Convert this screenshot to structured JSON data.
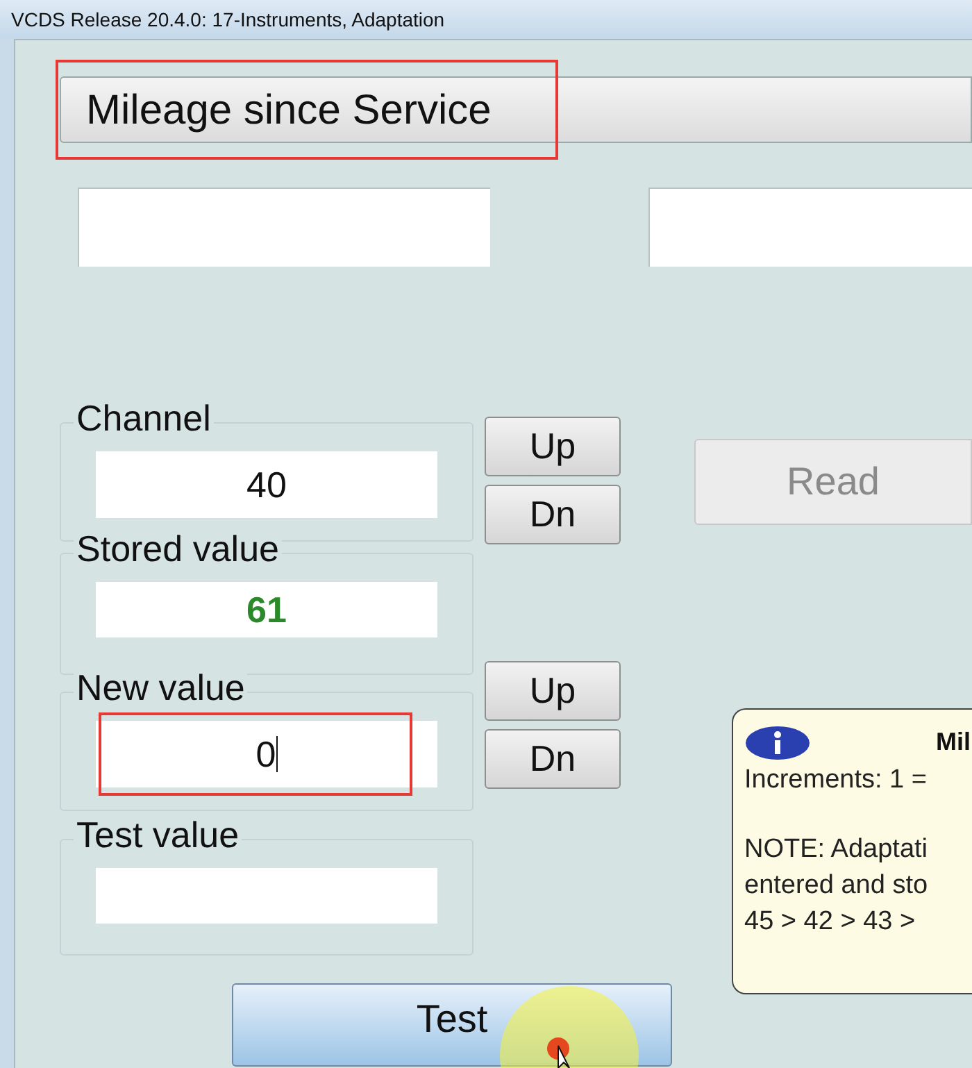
{
  "window": {
    "title": "VCDS Release 20.4.0: 17-Instruments,  Adaptation"
  },
  "channel_dropdown": {
    "value": "Mileage since Service",
    "highlighted": true
  },
  "channel": {
    "label": "Channel",
    "value": "40",
    "up": "Up",
    "down": "Dn"
  },
  "read_button": {
    "label": "Read",
    "disabled": true
  },
  "stored_value": {
    "label": "Stored value",
    "value": "61"
  },
  "new_value": {
    "label": "New value",
    "value": "0",
    "highlighted": true,
    "up": "Up",
    "down": "Dn"
  },
  "test_value": {
    "label": "Test value"
  },
  "info_tooltip": {
    "title": "Mil",
    "paragraphs": [
      [
        "Increments: 1 ="
      ],
      [
        "NOTE: Adaptati",
        "entered and sto",
        "45 > 42 > 43 >"
      ]
    ]
  },
  "test_button": {
    "label": "Test"
  }
}
